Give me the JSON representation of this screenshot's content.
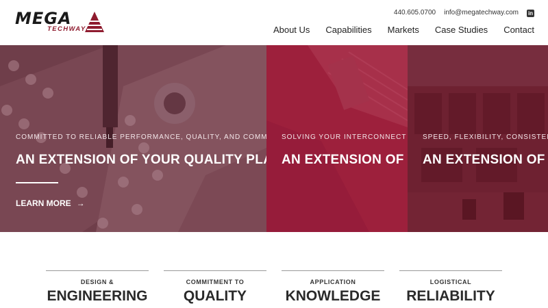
{
  "brand": {
    "name_primary": "MEGA",
    "name_secondary": "TECHWAY",
    "accent_color": "#8f1c2f"
  },
  "header": {
    "phone": "440.605.0700",
    "email": "info@megatechway.com",
    "social_icon": "linkedin-icon",
    "nav": [
      "About Us",
      "Capabilities",
      "Markets",
      "Case Studies",
      "Contact"
    ]
  },
  "hero": {
    "slides": [
      {
        "eyebrow": "COMMITTED TO RELIABLE PERFORMANCE, QUALITY, AND COMMUNICATION",
        "headline": "AN EXTENSION OF YOUR QUALITY PLAN",
        "cta": "LEARN MORE",
        "cta_icon": "arrow-right-icon"
      },
      {
        "eyebrow": "SOLVING YOUR INTERCONNECT DESIG",
        "headline": "AN EXTENSION OF YO"
      },
      {
        "eyebrow": "SPEED, FLEXIBILITY, CONSISTENCY A",
        "headline": "AN EXTENSION OF YO"
      }
    ]
  },
  "pillars": [
    {
      "small": "DESIGN &",
      "big": "ENGINEERING"
    },
    {
      "small": "COMMITMENT TO",
      "big": "QUALITY"
    },
    {
      "small": "APPLICATION",
      "big": "KNOWLEDGE"
    },
    {
      "small": "LOGISTICAL",
      "big": "RELIABILITY"
    }
  ]
}
